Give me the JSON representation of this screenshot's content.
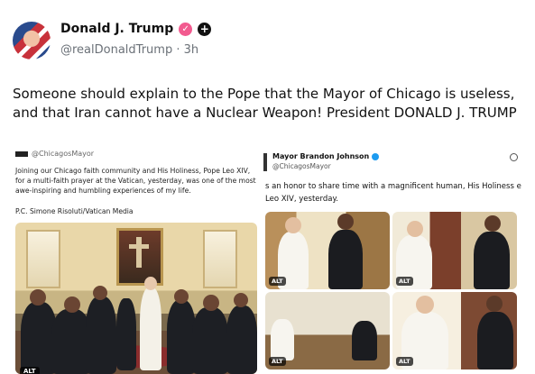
{
  "post": {
    "author_name": "Donald J. Trump",
    "handle": "@realDonaldTrump",
    "separator": "·",
    "time": "3h",
    "text": "Someone should explain to the Pope that the Mayor of Chicago is useless, and that Iran cannot have a Nuclear Weapon! President DONALD J. TRUMP"
  },
  "left_screenshot": {
    "handle": "@ChicagosMayor",
    "body": "Joining our Chicago faith community and His Holiness, Pope Leo XIV, for a multi-faith prayer at the Vatican, yesterday, was one of the most awe-inspiring and humbling experiences of my life.",
    "credit": "P.C. Simone Risoluti/Vatican Media",
    "alt_label": "ALT"
  },
  "right_screenshot": {
    "name": "Mayor Brandon Johnson",
    "handle": "@ChicagosMayor",
    "body": "s an honor to share time with a magnificent human, His Holiness e Leo XIV, yesterday.",
    "alt_labels": [
      "ALT",
      "ALT",
      "ALT",
      "ALT"
    ]
  }
}
